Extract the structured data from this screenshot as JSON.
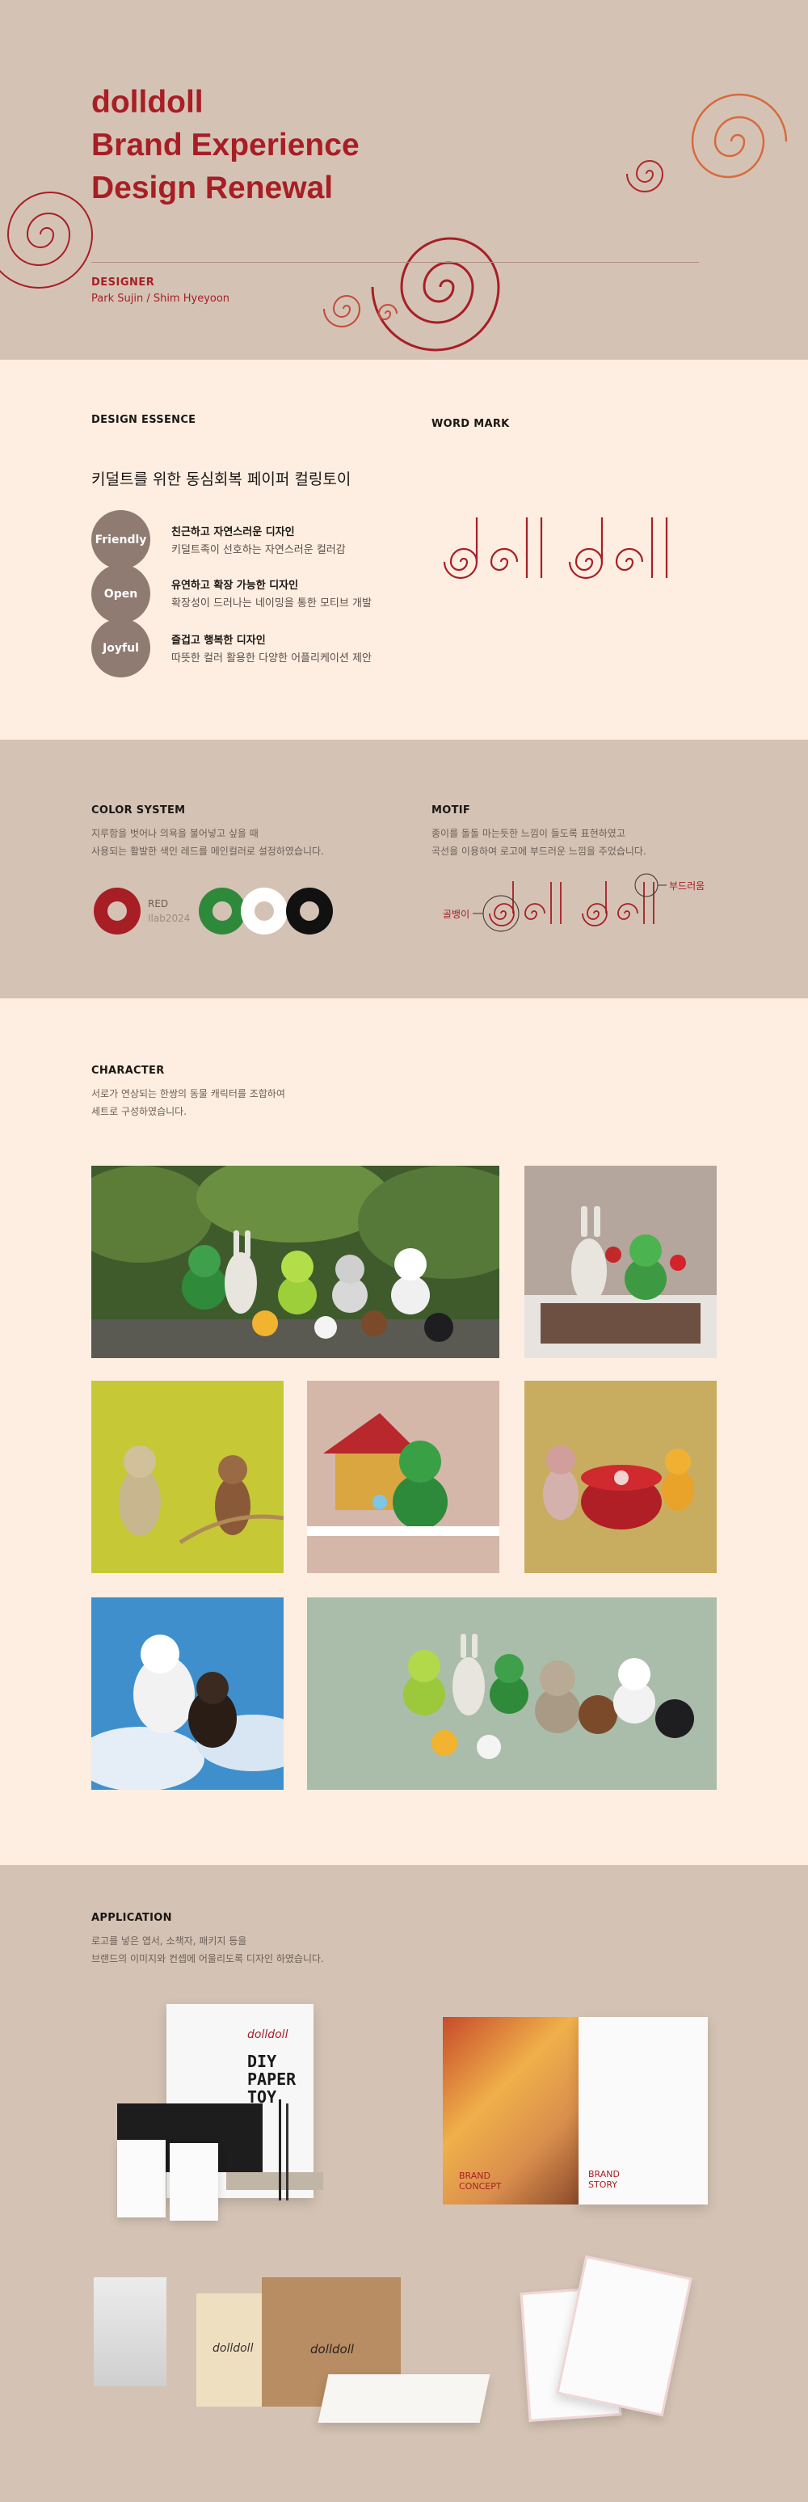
{
  "hero": {
    "title_line1": "dolldoll",
    "title_line2": "Brand Experience",
    "title_line3": "Design Renewal",
    "designer_label": "DESIGNER",
    "designer_names": "Park Sujin / Shim Hyeyoon"
  },
  "essence": {
    "section_label": "DESIGN ESSENCE",
    "headline": "키덜트를 위한 동심회복 페이퍼 컬링토이",
    "items": [
      {
        "badge": "Friendly",
        "title": "친근하고 자연스러운 디자인",
        "desc": "키덜트족이 선호하는 자연스러운 컬러감"
      },
      {
        "badge": "Open",
        "title": "유연하고 확장 가능한 디자인",
        "desc": "확장성이 드러나는 네이밍을 통한 모티브 개발"
      },
      {
        "badge": "Joyful",
        "title": "즐겁고 행복한 디자인",
        "desc": "따뜻한 컬러 활용한 다양한 어플리케이션 제안"
      }
    ]
  },
  "wordmark": {
    "section_label": "WORD MARK",
    "text": "dolldoll"
  },
  "color_system": {
    "section_label": "COLOR SYSTEM",
    "desc_line1": "지루함을 벗어나 의욕을 불어넣고 싶을 때",
    "desc_line2": "사용되는 활발한 색인 레드를  메인컬러로 설정하였습니다.",
    "main_name": "RED",
    "main_code": "Ilab2024",
    "colors": {
      "red": "#a81e25",
      "green": "#2e8a3a",
      "white": "#ffffff",
      "black": "#111111"
    }
  },
  "motif": {
    "section_label": "MOTIF",
    "desc_line1": "종이를 돌돌 마는듯한 느낌이 들도록 표현하였고",
    "desc_line2": "곡선을 이용하여 로고에 부드러운 느낌을 주었습니다.",
    "label_left": "골뱅이",
    "label_right": "부드러움"
  },
  "character": {
    "section_label": "CHARACTER",
    "desc_line1": "서로가 연상되는 한쌍의 동물 캐릭터를 조합하여",
    "desc_line2": "세트로 구성하였습니다."
  },
  "application": {
    "section_label": "APPLICATION",
    "desc_line1": "로고를 넣은 엽서, 소책자, 패키지 등을",
    "desc_line2": "브랜드의 이미지와 컨셉에 어울리도록 디자인 하였습니다.",
    "poster_text": "DIY PAPER TOY",
    "book_text_left": "BRAND CONCEPT",
    "book_text_right": "BRAND STORY"
  }
}
